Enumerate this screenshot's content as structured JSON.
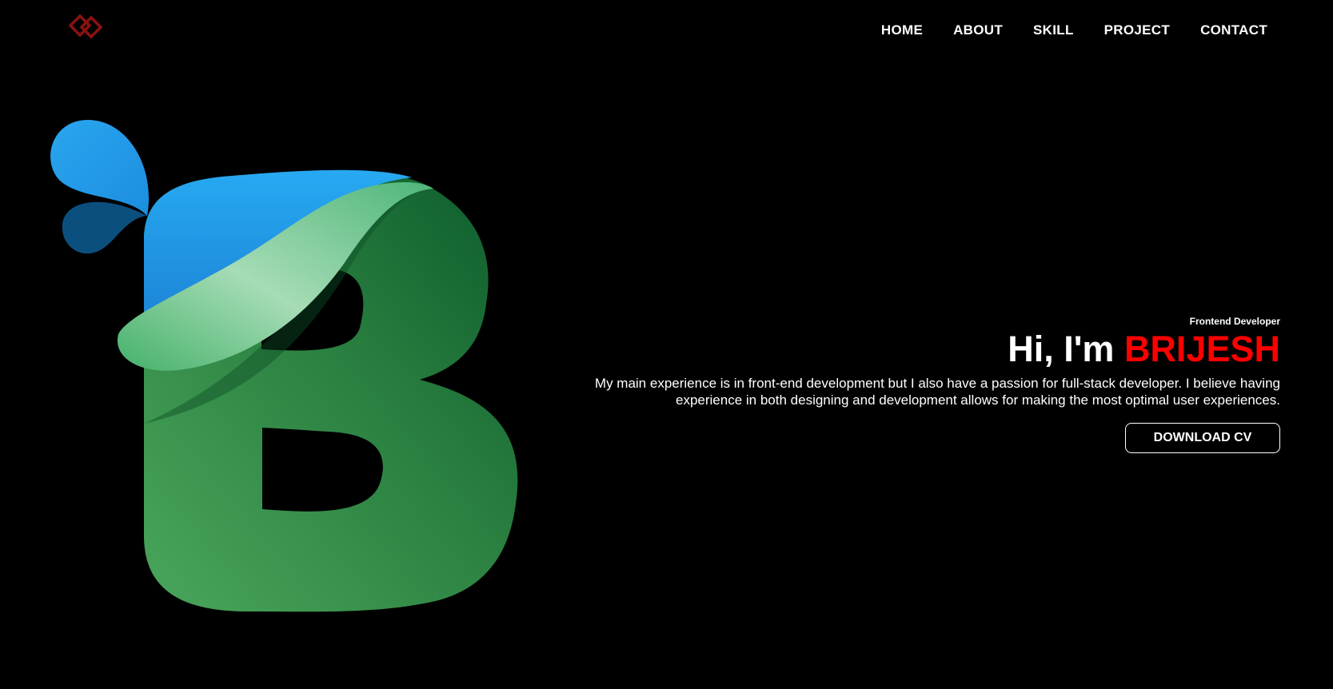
{
  "nav": {
    "items": [
      {
        "label": "HOME"
      },
      {
        "label": "ABOUT"
      },
      {
        "label": "SKILL"
      },
      {
        "label": "PROJECT"
      },
      {
        "label": "CONTACT"
      }
    ]
  },
  "logo": {
    "icon": "diamond-chain-logo-icon",
    "color": "#8b1212"
  },
  "hero": {
    "role": "Frontend Developer",
    "greeting_prefix": "Hi, I'm ",
    "name": "BRIJESH",
    "bio": "My main experience is in front-end development but I also have a passion for full-stack developer. I believe having experience in both designing and development allows for making the most optimal user experiences.",
    "download_label": "DOWNLOAD CV"
  },
  "colors": {
    "background": "#000000",
    "accent": "#ff0000",
    "art_green": "#2e8b4a",
    "art_blue": "#24a0e8"
  }
}
